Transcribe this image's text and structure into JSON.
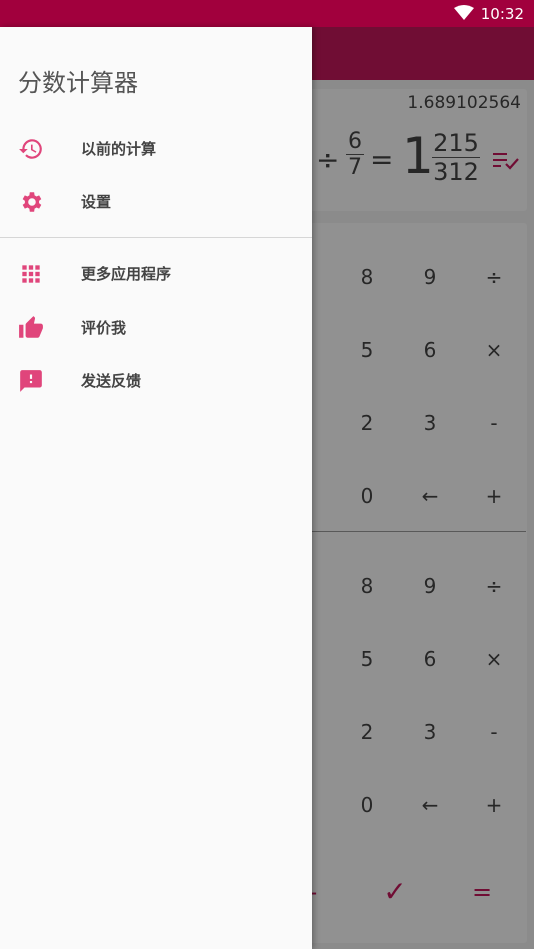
{
  "status_bar": {
    "time": "10:32"
  },
  "colors": {
    "accent": "#c2185b",
    "status": "#a1003d",
    "icon": "#e0457b"
  },
  "display": {
    "decimal": "1.689102564",
    "divide_sign": "÷",
    "frac_num": "6",
    "frac_den": "7",
    "equals_sign": "=",
    "result_whole": "1",
    "result_num": "215",
    "result_den": "312"
  },
  "keypad": {
    "upper": [
      [
        "8",
        "9",
        "÷"
      ],
      [
        "5",
        "6",
        "×"
      ],
      [
        "2",
        "3",
        "-"
      ],
      [
        "0",
        "←",
        "+"
      ]
    ],
    "lower": [
      [
        "8",
        "9",
        "÷"
      ],
      [
        "5",
        "6",
        "×"
      ],
      [
        "2",
        "3",
        "-"
      ],
      [
        "0",
        "←",
        "+"
      ]
    ],
    "bottom": {
      "minus": "-",
      "check": "✓",
      "equals": "="
    }
  },
  "drawer": {
    "title": "分数计算器",
    "items": [
      {
        "label": "以前的计算",
        "icon": "history-icon"
      },
      {
        "label": "设置",
        "icon": "gear-icon"
      },
      {
        "label": "更多应用程序",
        "icon": "apps-grid-icon"
      },
      {
        "label": "评价我",
        "icon": "thumbs-up-icon"
      },
      {
        "label": "发送反馈",
        "icon": "feedback-icon"
      }
    ]
  }
}
